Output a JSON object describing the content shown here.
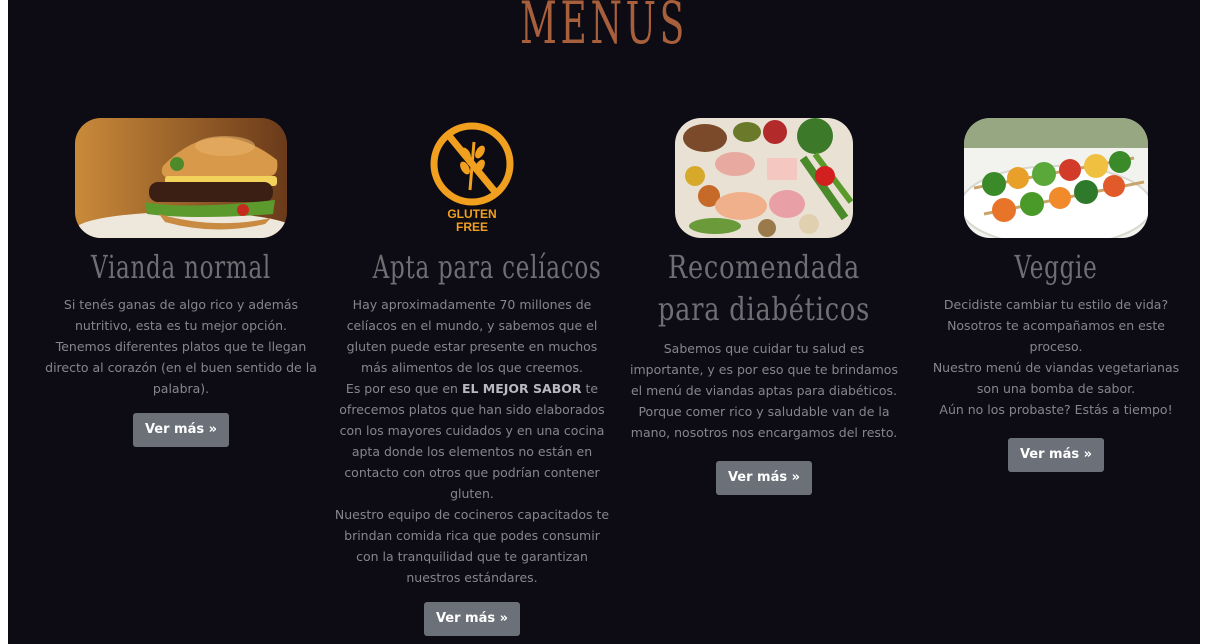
{
  "section": {
    "title": "MENÚS"
  },
  "cards": [
    {
      "title": "Vianda normal",
      "text": [
        "Si tenés ganas de algo rico y además nutritivo, esta es tu mejor opción.",
        "Tenemos diferentes platos que te llegan directo al corazón (en el buen sentido de la palabra)."
      ],
      "button": "Ver más »"
    },
    {
      "title": "Apta para celíacos",
      "badge_top": "GLUTEN",
      "badge_bottom": "FREE",
      "text": {
        "p1": "Hay aproximadamente 70 millones de celíacos en el mundo, y sabemos que el gluten puede estar presente en muchos más alimentos de los que creemos.",
        "p2_before": "Es por eso que en ",
        "p2_bold": "EL MEJOR SABOR",
        "p2_after": " te ofrecemos platos que han sido elaborados con los mayores cuidados y en una cocina apta donde los elementos no están en contacto con otros que podrían contener gluten.",
        "p3": "Nuestro equipo de cocineros capacitados te brindan comida rica que podes consumir con la tranquilidad que te garantizan nuestros estándares."
      },
      "button": "Ver más »"
    },
    {
      "title": "Recomendada para diabéticos",
      "text": [
        "Sabemos que cuidar tu salud es importante, y es por eso que te brindamos el menú de viandas aptas para diabéticos.",
        "Porque comer rico y saludable van de la mano, nosotros nos encargamos del resto."
      ],
      "button": "Ver más »"
    },
    {
      "title": "Veggie",
      "text": [
        "Decidiste cambiar tu estilo de vida? Nosotros te acompañamos en este proceso.",
        "Nuestro menú de viandas vegetarianas son una bomba de sabor.",
        "Aún no los probaste? Estás a tiempo!"
      ],
      "button": "Ver más »"
    }
  ],
  "colors": {
    "background": "#0d0c14",
    "title": "#a8603c",
    "card_title": "#6f6e73",
    "text": "#86858c",
    "button": "#6b7079",
    "badge": "#f0a01e"
  }
}
